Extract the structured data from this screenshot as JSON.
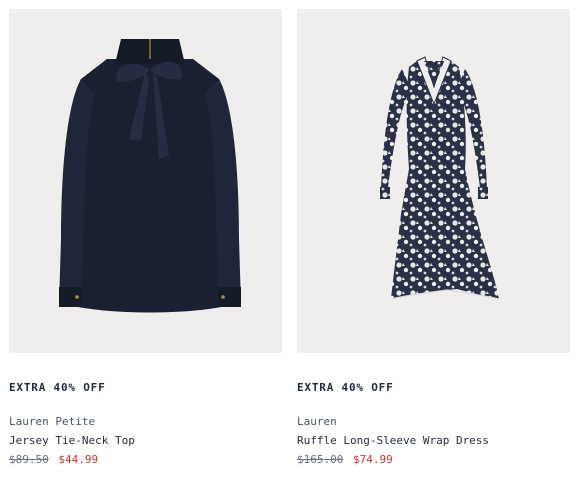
{
  "products": [
    {
      "badge": "EXTRA 40% OFF",
      "brand": "Lauren Petite",
      "name": "Jersey Tie-Neck Top",
      "original_price": "$89.50",
      "sale_price": "$44.99",
      "image_icon": "tie-neck-top-photo"
    },
    {
      "badge": "EXTRA 40% OFF",
      "brand": "Lauren",
      "name": "Ruffle Long-Sleeve Wrap Dress",
      "original_price": "$165.00",
      "sale_price": "$74.99",
      "image_icon": "wrap-dress-photo"
    }
  ],
  "colors": {
    "image_bg": "#efeeec",
    "navy": "#1b2030",
    "sale": "#c0392b"
  }
}
